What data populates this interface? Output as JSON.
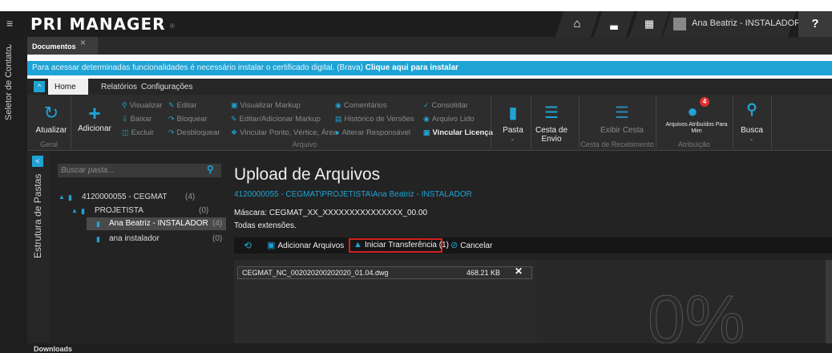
{
  "app": {
    "menu_glyph": "≡",
    "logo_text": "PRI MANAGER",
    "logo_mark": "®"
  },
  "topbar": {
    "home_glyph": "⌂",
    "chart_glyph": "▃",
    "calendar_glyph": "▦",
    "user_name": "Ana Beatriz - INSTALADOR",
    "help_label": "?"
  },
  "siderail": {
    "chevron": "›",
    "label": "Seletor de Contato"
  },
  "doc_tab": {
    "label": "Documentos",
    "close": "×"
  },
  "banner": {
    "text": "Para acessar determinadas funcionalidades é necessário instalar o certificado digital. (Brava) ",
    "link": "Clique aqui para instalar"
  },
  "ribbon_tabs": {
    "collapse_glyph": "^",
    "home": "Home",
    "relatorios": "Relatórios",
    "configuracoes": "Configurações"
  },
  "ribbon": {
    "atualizar": {
      "icon": "↻",
      "label": "Atualizar"
    },
    "adicionar": {
      "icon": "+",
      "label": "Adicionar"
    },
    "visualizar": "Visualizar",
    "baixar": "Baixar",
    "excluir": "Excluir",
    "editar": "Editar",
    "bloquear": "Bloquear",
    "desbloquear": "Desbloquear",
    "visualizar_markup": "Visualizar Markup",
    "editar_markup": "Editar/Adicionar Markup",
    "vincular_ponto": "Vincular Ponto, Vértice, Área",
    "comentarios": "Comentários",
    "historico": "Histórico de Versões",
    "alterar_responsavel": "Alterar Responsável",
    "consolidar": "Consolidar",
    "arquivo_lido": "Arquivo Lido",
    "vincular_licenca": "Vincular Licença",
    "pasta": "Pasta",
    "cesta_envio": "Cesta de Envio",
    "exibir_cesta": "Exibir Cesta",
    "arquivos_atribuidos": "Arquivos Atribuídos Para Mim",
    "badge_count": "4",
    "busca": "Busca",
    "group_geral": "Geral",
    "group_arquivo": "Arquivo",
    "group_cesta": "Cesta de Recebimento",
    "group_atribuicao": "Atribuição"
  },
  "folders": {
    "rail_label": "Estrutura de Pastas",
    "collapse_glyph": "<",
    "search_placeholder": "Buscar pasta...",
    "tree": [
      {
        "label": "4120000055 - CEGMAT",
        "count": "(4)"
      },
      {
        "label": "PROJETISTA",
        "count": "(0)"
      },
      {
        "label": "Ana Beatriz - INSTALADOR",
        "count": "(4)"
      },
      {
        "label": "ana instalador",
        "count": "(0)"
      }
    ]
  },
  "upload": {
    "title": "Upload de Arquivos",
    "path": "4120000055 - CEGMAT\\PROJETISTA\\Ana Beatriz - INSTALADOR",
    "mask": "Máscara: CEGMAT_XX_XXXXXXXXXXXXXXX_00.00",
    "extensions": "Todas extensões.",
    "toolbar": {
      "add_files": "Adicionar Arquivos",
      "start_transfer": "Iniciar Transferência (1)",
      "cancel": "Cancelar"
    },
    "files": [
      {
        "name": "CEGMAT_NC_002020200202020_01.04.dwg",
        "size": "468.21 KB"
      }
    ],
    "progress_percent": 0,
    "progress_text": "0%"
  },
  "downloads": {
    "label": "Downloads"
  }
}
